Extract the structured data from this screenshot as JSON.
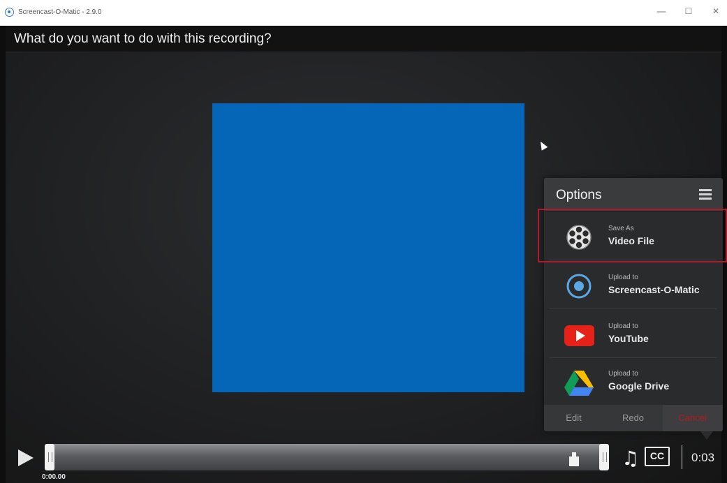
{
  "window": {
    "title": "Screencast-O-Matic - 2.9.0",
    "minimize_glyph": "—",
    "maximize_glyph": "☐",
    "close_glyph": "✕"
  },
  "question": "What do you want to do with this recording?",
  "preview": {
    "color": "#0566b7"
  },
  "options": {
    "title": "Options",
    "items": [
      {
        "small": "Save As",
        "big": "Video File",
        "icon": "film-reel-icon"
      },
      {
        "small": "Upload to",
        "big": "Screencast-O-Matic",
        "icon": "screencast-o-matic-icon"
      },
      {
        "small": "Upload to",
        "big": "YouTube",
        "icon": "youtube-icon"
      },
      {
        "small": "Upload to",
        "big": "Google Drive",
        "icon": "google-drive-icon"
      }
    ],
    "footer": {
      "edit": "Edit",
      "redo": "Redo",
      "cancel": "Cancel"
    },
    "highlight_color": "#b3182c"
  },
  "player": {
    "current_time": "0:00.00",
    "duration": "0:03",
    "cc_label": "CC",
    "music_glyph": "♫"
  }
}
